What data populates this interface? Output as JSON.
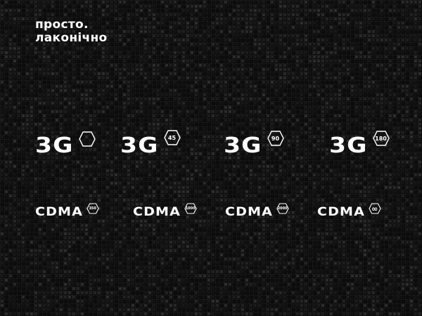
{
  "tagline": {
    "line1": "просто.",
    "line2": "лаконічно"
  },
  "logos_3g": [
    {
      "text": "3G",
      "badge": ""
    },
    {
      "text": "3G",
      "badge": "45"
    },
    {
      "text": "3G",
      "badge": "90"
    },
    {
      "text": "3G",
      "badge": "180"
    }
  ],
  "logos_cdma": [
    {
      "text": "CDMA",
      "badge": "350"
    },
    {
      "text": "CDMA",
      "badge": "1000"
    },
    {
      "text": "CDMA",
      "badge": "2000"
    },
    {
      "text": "CDMA",
      "badge": "∞"
    }
  ],
  "colors": {
    "background": "#0b0b0b",
    "foreground": "#ffffff"
  }
}
